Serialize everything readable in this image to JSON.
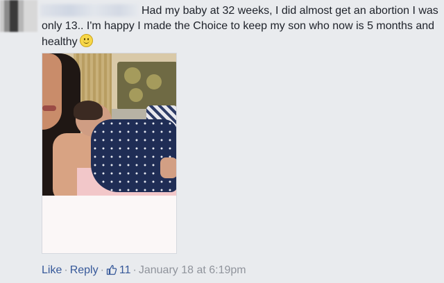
{
  "comment": {
    "text": "Had my baby at 32 weeks, I did almost get an abortion I was only 13.. I'm happy I made the Choice to keep my son who now is 5 months and healthy",
    "emoji": "smile-emoji"
  },
  "footer": {
    "like_label": "Like",
    "reply_label": "Reply",
    "separator": "·",
    "like_count": "11",
    "timestamp": "January 18 at 6:19pm"
  },
  "colors": {
    "background": "#e9ebee",
    "text": "#1d2129",
    "link": "#365899",
    "meta": "#90949c"
  }
}
